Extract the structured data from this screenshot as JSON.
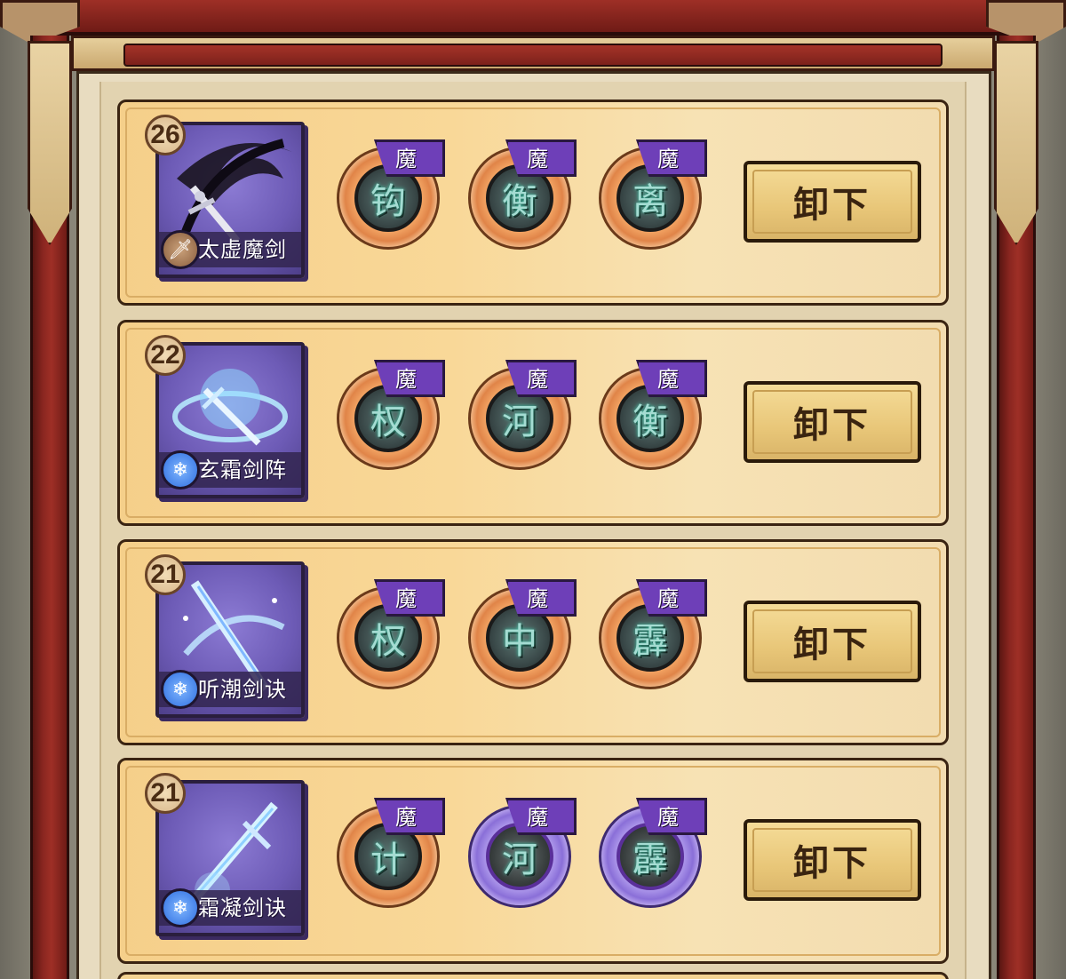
{
  "skills": [
    {
      "level": "26",
      "name": "太虚魔剑",
      "type_icon": "sword-icon",
      "type_glyph": "🗡",
      "badge_color": "#a8754e",
      "gems": [
        {
          "tag": "魔",
          "rune": "钩",
          "style": "orange"
        },
        {
          "tag": "魔",
          "rune": "衡",
          "style": "orange"
        },
        {
          "tag": "魔",
          "rune": "离",
          "style": "orange"
        }
      ],
      "button": "卸下"
    },
    {
      "level": "22",
      "name": "玄霜剑阵",
      "type_icon": "snowflake-icon",
      "type_glyph": "❄",
      "badge_color": "#2f6ee0",
      "gems": [
        {
          "tag": "魔",
          "rune": "权",
          "style": "orange"
        },
        {
          "tag": "魔",
          "rune": "河",
          "style": "orange"
        },
        {
          "tag": "魔",
          "rune": "衡",
          "style": "orange"
        }
      ],
      "button": "卸下"
    },
    {
      "level": "21",
      "name": "听潮剑诀",
      "type_icon": "snowflake-icon",
      "type_glyph": "❄",
      "badge_color": "#2f6ee0",
      "gems": [
        {
          "tag": "魔",
          "rune": "权",
          "style": "orange"
        },
        {
          "tag": "魔",
          "rune": "中",
          "style": "orange"
        },
        {
          "tag": "魔",
          "rune": "霹",
          "style": "orange"
        }
      ],
      "button": "卸下"
    },
    {
      "level": "21",
      "name": "霜凝剑诀",
      "type_icon": "snowflake-icon",
      "type_glyph": "❄",
      "badge_color": "#2f6ee0",
      "gems": [
        {
          "tag": "魔",
          "rune": "计",
          "style": "orange"
        },
        {
          "tag": "魔",
          "rune": "河",
          "style": "purple"
        },
        {
          "tag": "魔",
          "rune": "霹",
          "style": "purple"
        }
      ],
      "button": "卸下"
    }
  ],
  "colors": {
    "card_purple": "#6d5bb6",
    "gem_tag_purple": "#6e3fb8",
    "row_gold": "#f9d898",
    "frame_red": "#9e2f26"
  }
}
